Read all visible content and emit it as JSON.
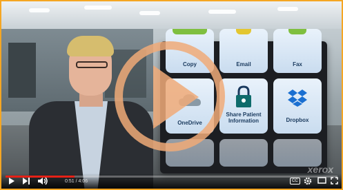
{
  "player": {
    "current_time": "0:51",
    "duration": "4:06",
    "time_separator": " / ",
    "progress_fraction": 0.207,
    "accent_color": "#f5a623",
    "progress_color": "#e62117"
  },
  "device_tiles": [
    {
      "label": "Copy",
      "icon": "copy-icon"
    },
    {
      "label": "Email",
      "icon": "email-icon"
    },
    {
      "label": "Fax",
      "icon": "fax-icon"
    },
    {
      "label": "OneDrive",
      "icon": "onedrive-icon"
    },
    {
      "label": "Share Patient Information",
      "icon": "lock-icon"
    },
    {
      "label": "Dropbox",
      "icon": "dropbox-icon"
    }
  ],
  "watermark": "xerox",
  "icons": [
    "play-icon",
    "next-icon",
    "volume-icon",
    "cc-icon",
    "settings-icon",
    "theater-icon",
    "fullscreen-icon"
  ]
}
